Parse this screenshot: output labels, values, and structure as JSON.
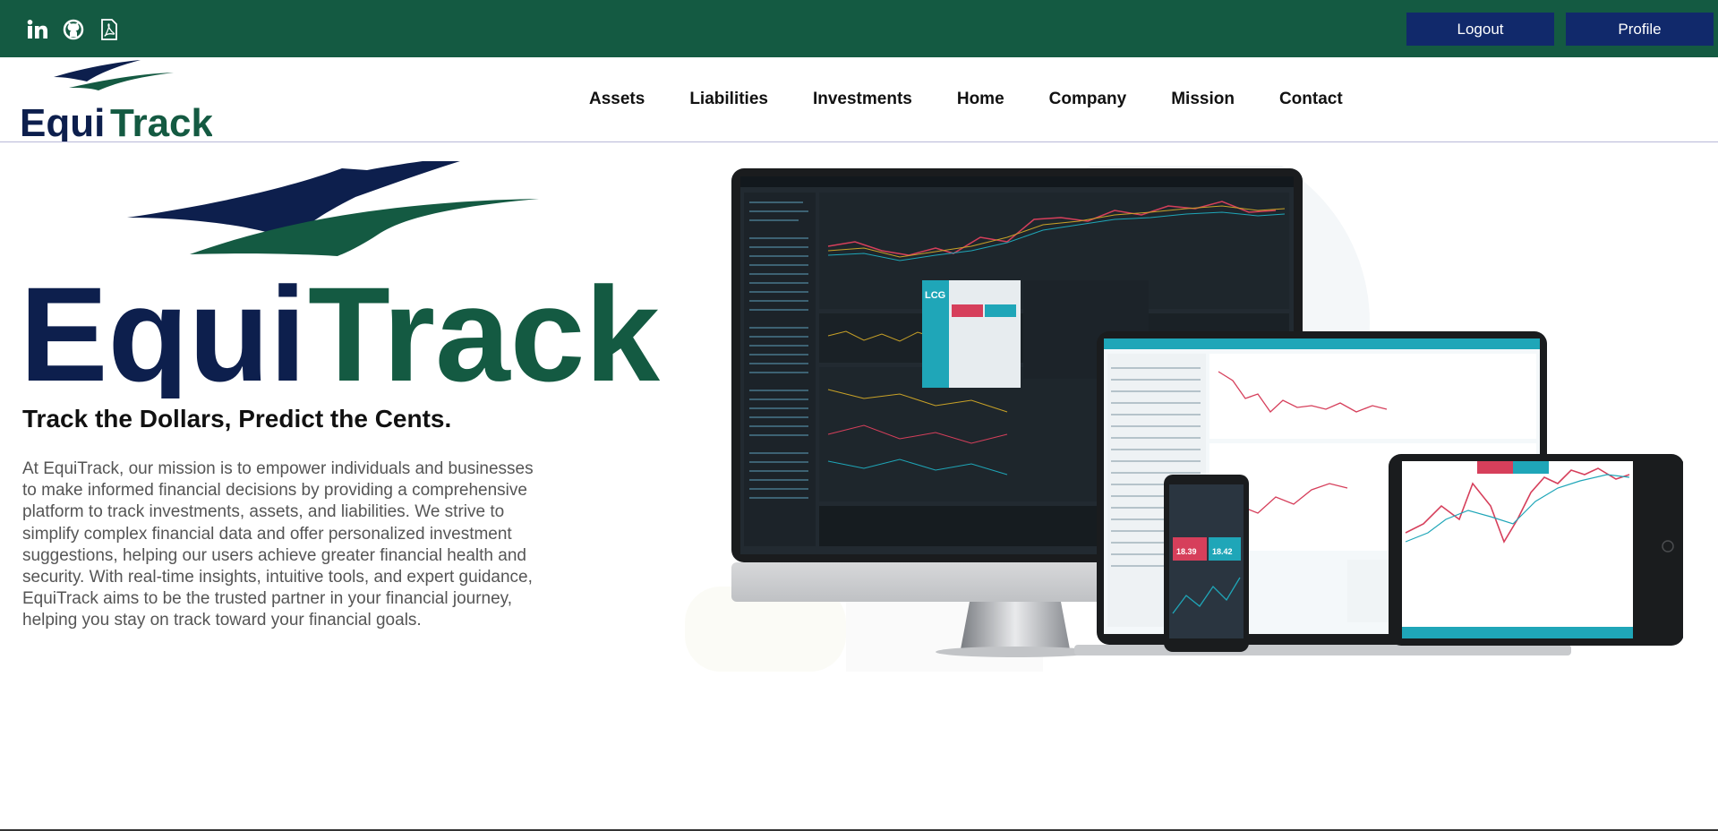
{
  "topbar": {
    "social_icons": [
      "linkedin-icon",
      "github-icon",
      "pdf-icon"
    ],
    "logout_label": "Logout",
    "profile_label": "Profile"
  },
  "brand": {
    "name_part1": "Equi",
    "name_part2": "Track",
    "primary_color": "#0d1f4d",
    "accent_color": "#145a42"
  },
  "nav": {
    "items": [
      {
        "label": "Assets"
      },
      {
        "label": "Liabilities"
      },
      {
        "label": "Investments"
      },
      {
        "label": "Home"
      },
      {
        "label": "Company"
      },
      {
        "label": "Mission"
      },
      {
        "label": "Contact"
      }
    ]
  },
  "hero": {
    "tagline": "Track the Dollars, Predict the Cents.",
    "mission": "At EquiTrack, our mission is to empower individuals and businesses to make informed financial decisions by providing a comprehensive platform to track investments, assets, and liabilities. We strive to simplify complex financial data and offer personalized investment suggestions, helping our users achieve greater financial health and security. With real-time insights, intuitive tools, and expert guidance, EquiTrack aims to be the trusted partner in your financial journey, helping you stay on track toward your financial goals.",
    "device_badge": "LCG",
    "phone_prices": [
      "18.39",
      "18.42"
    ]
  }
}
